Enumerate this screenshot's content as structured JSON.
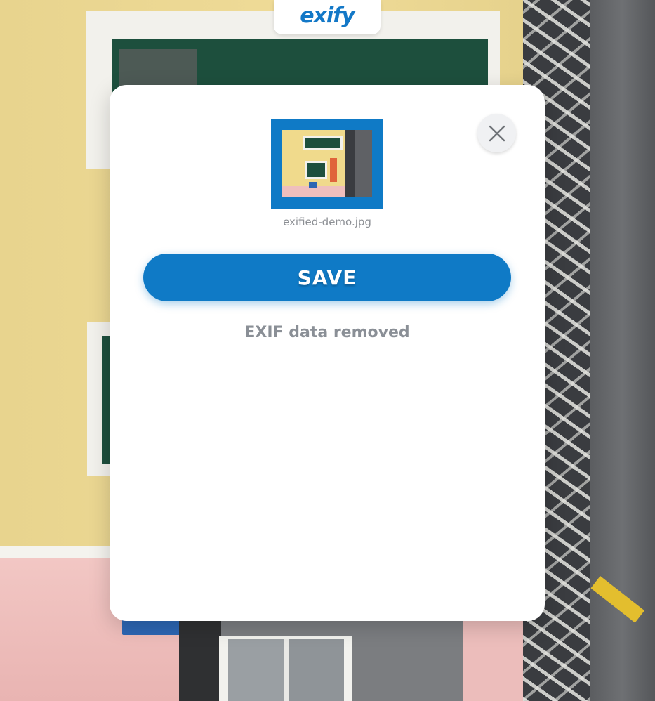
{
  "app": {
    "logo_text": "exify"
  },
  "modal": {
    "filename": "exified-demo.jpg",
    "save_label": "SAVE",
    "status_text": "EXIF data removed",
    "close_icon": "close-icon",
    "thumbnail_icon": "image-thumbnail"
  },
  "colors": {
    "accent": "#0f7ac6",
    "status_text": "#8a8f96",
    "modal_bg": "#ffffff"
  }
}
